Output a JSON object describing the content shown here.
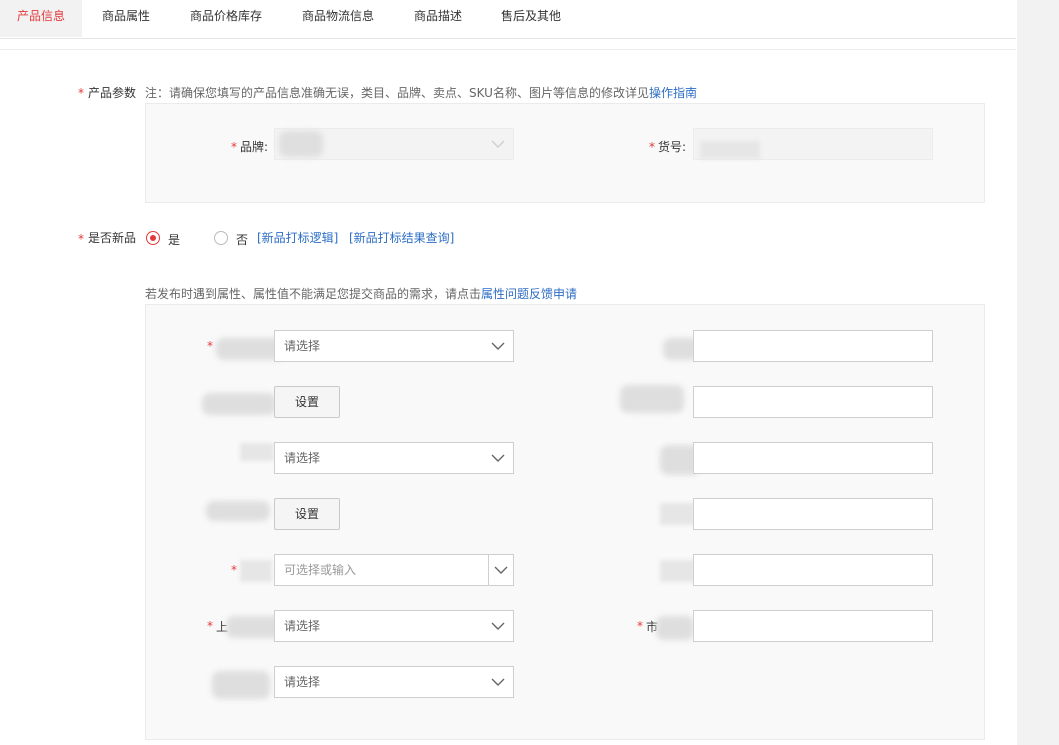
{
  "tabs": [
    {
      "label": "产品信息",
      "active": true
    },
    {
      "label": "商品属性"
    },
    {
      "label": "商品价格库存"
    },
    {
      "label": "商品物流信息"
    },
    {
      "label": "商品描述"
    },
    {
      "label": "售后及其他"
    }
  ],
  "required_mark": "*",
  "product_params": {
    "label": "产品参数",
    "note": "注：请确保您填写的产品信息准确无误，类目、品牌、卖点、SKU名称、图片等信息的修改详见",
    "guide_link": "操作指南",
    "brand_label": "品牌:",
    "item_no_label": "货号:"
  },
  "new_product": {
    "label": "是否新品",
    "yes": "是",
    "no": "否",
    "selected": "yes",
    "link_logic": "[新品打标逻辑]",
    "link_result": "[新品打标结果查询]"
  },
  "attributes": {
    "note": "若发布时遇到属性、属性值不能满足您提交商品的需求，请点击",
    "feedback_link": "属性问题反馈申请",
    "select_placeholder": "请选择",
    "combo_placeholder": "可选择或输入",
    "setup_button": "设置",
    "partial_label_shang": "上",
    "partial_label_shi": "市"
  },
  "colors": {
    "accent_red": "#e4393c",
    "link_blue": "#2d6ec5"
  },
  "icons": [
    "chevron-down-icon",
    "radio-icon"
  ]
}
